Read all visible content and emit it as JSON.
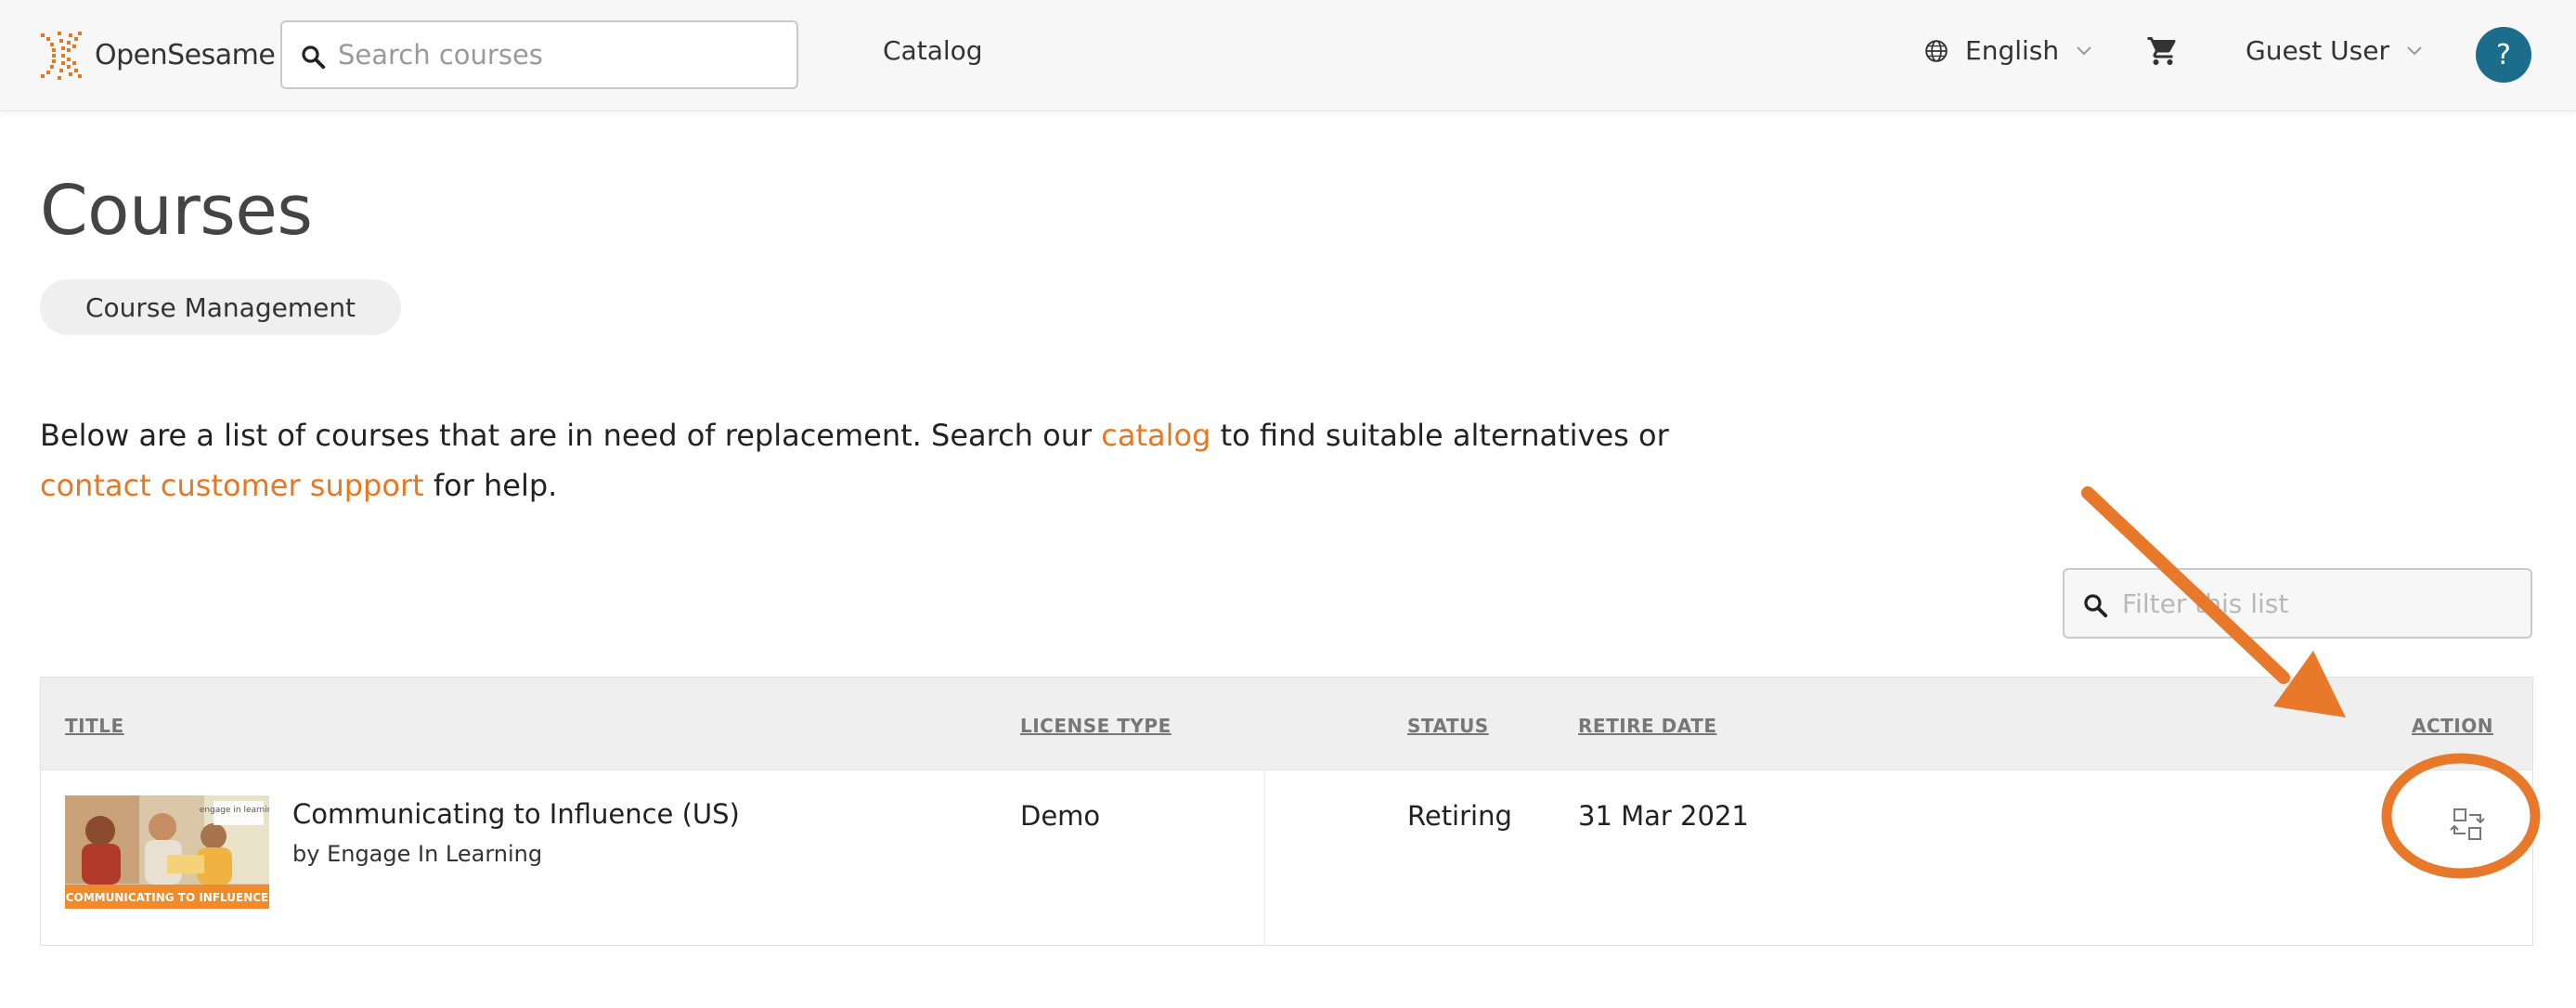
{
  "header": {
    "logo_text": "OpenSesame",
    "search_placeholder": "Search courses",
    "nav_catalog": "Catalog",
    "language": "English",
    "user": "Guest User",
    "help": "?"
  },
  "page": {
    "title": "Courses",
    "pill_label": "Course Management",
    "intro_before": "Below are a list of courses that are in need of replacement. Search our ",
    "intro_link_catalog": "catalog",
    "intro_middle": " to find suitable alternatives or ",
    "intro_link_support": "contact customer support",
    "intro_after": " for help.",
    "filter_placeholder": "Filter this list"
  },
  "table": {
    "columns": [
      "TITLE",
      "LICENSE TYPE",
      "STATUS",
      "RETIRE DATE",
      "ACTION"
    ],
    "rows": [
      {
        "title": "Communicating to Influence (US)",
        "author": "by Engage In Learning",
        "license_type": "Demo",
        "status": "Retiring",
        "retire_date": "31 Mar 2021",
        "thumbnail_caption": "COMMUNICATING TO INFLUENCE",
        "thumbnail_brand": "engage in learning"
      }
    ]
  },
  "colors": {
    "accent": "#e87722",
    "help_button": "#1c6c8c",
    "annotation": "#e8792a"
  },
  "icons": {
    "search": "search-icon",
    "globe": "globe-icon",
    "cart": "cart-icon",
    "chevron": "chevron-down-icon",
    "action": "replace-course-icon"
  }
}
